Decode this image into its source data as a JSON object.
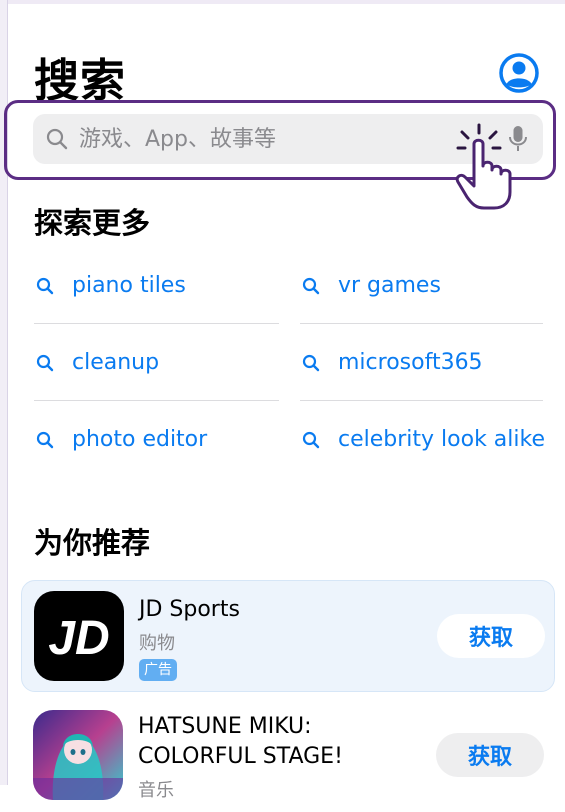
{
  "header": {
    "title": "搜索",
    "account_icon": "person-circle-icon"
  },
  "search": {
    "placeholder": "游戏、App、故事等",
    "icon": "magnifier-icon",
    "mic_icon": "microphone-icon"
  },
  "explore": {
    "title": "探索更多",
    "left": [
      "piano tiles",
      "cleanup",
      "photo editor"
    ],
    "right": [
      "vr games",
      "microsoft365",
      "celebrity look alike"
    ]
  },
  "recommend": {
    "title": "为你推荐",
    "apps": [
      {
        "name": "JD Sports",
        "category": "购物",
        "badge": "广告",
        "button": "获取"
      },
      {
        "name_line1": "HATSUNE MIKU:",
        "name_line2": "COLORFUL STAGE!",
        "category": "音乐",
        "button": "获取"
      }
    ]
  },
  "colors": {
    "accent": "#0a7bf0",
    "highlight": "#5b2d84",
    "ad_bg": "#edf4fc",
    "badge": "#62aef2"
  }
}
